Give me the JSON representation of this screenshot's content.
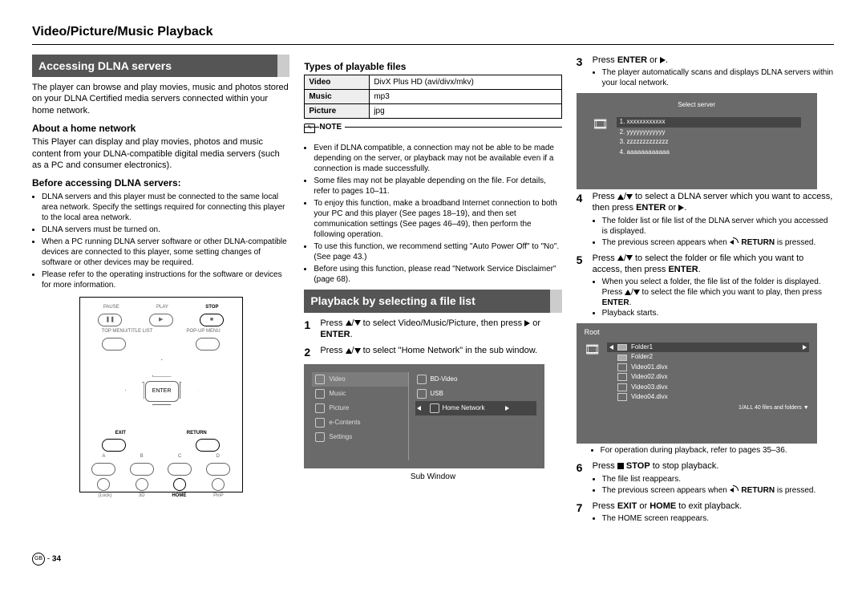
{
  "header": "Video/Picture/Music Playback",
  "col1": {
    "section1": "Accessing DLNA servers",
    "intro": "The player can browse and play movies, music and photos stored on your DLNA Certified media servers connected within your home network.",
    "about_head": "About a home network",
    "about_body": "This Player can display and play movies, photos and music content from your DLNA-compatible digital media servers (such as a PC and consumer electronics).",
    "before_head": "Before accessing DLNA servers:",
    "before_items": [
      "DLNA servers and this player must be connected to the same local area network. Specify the settings required for connecting this player to the local area network.",
      "DLNA servers must be turned on.",
      "When a PC running DLNA server software or other DLNA-compatible devices are connected to this player, some setting changes of software or other devices may be required.",
      "Please refer to the operating instructions for the software or devices for more information."
    ]
  },
  "remote": {
    "pause": "PAUSE",
    "play": "PLAY",
    "stop": "STOP",
    "topmenu": "TOP MENU/TITLE LIST",
    "popup": "POP-UP MENU",
    "enter": "ENTER",
    "exit": "EXIT",
    "return": "RETURN",
    "a": "A",
    "b": "B",
    "c": "C",
    "d": "D",
    "lock": "(Lock)",
    "three_d": "3D",
    "home": "HOME",
    "pinp": "PinP"
  },
  "col2": {
    "types_head": "Types of playable files",
    "types_rows": [
      [
        "Video",
        "DivX Plus HD (avi/divx/mkv)"
      ],
      [
        "Music",
        "mp3"
      ],
      [
        "Picture",
        "jpg"
      ]
    ],
    "note_label": "NOTE",
    "note_items": [
      "Even if DLNA compatible, a connection may not be able to be made depending on the server, or playback may not be available even if a connection is made successfully.",
      "Some files may not be playable depending on the file. For details, refer to pages 10–11.",
      "To enjoy this function, make a broadband Internet connection to both your PC and this player (See pages 18–19), and then set communication settings (See pages 46–49), then perform the following operation.",
      "To use this function, we recommend setting \"Auto Power Off\" to \"No\". (See page 43.)",
      "Before using this function, please read \"Network Service Disclaimer\" (page 68)."
    ],
    "section2": "Playback by selecting a file list",
    "step1_a": "Press ",
    "step1_b": " to select Video/Music/Picture, then press ",
    "step1_c": " or ",
    "step1_enter": "ENTER",
    "step1_d": ".",
    "step2_a": "Press ",
    "step2_b": " to select \"Home Network\" in the sub window.",
    "menu_left": [
      "Video",
      "Music",
      "Picture",
      "e-Contents",
      "Settings"
    ],
    "menu_right": [
      "BD-Video",
      "USB",
      "Home Network"
    ],
    "sub_window": "Sub Window"
  },
  "col3": {
    "step3_a": "Press ",
    "step3_enter": "ENTER",
    "step3_b": " or ",
    "step3_c": ".",
    "step3_li": "The player automatically scans and displays DLNA servers within your local network.",
    "server_title": "Select server",
    "server_items": [
      "1. xxxxxxxxxxxx",
      "2. yyyyyyyyyyyy",
      "3. zzzzzzzzzzzzz",
      "4. aaaaaaaaaaaa"
    ],
    "step4_a": "Press ",
    "step4_b": " to select a DLNA server which you want to access, then press ",
    "step4_enter": "ENTER",
    "step4_c": " or ",
    "step4_d": ".",
    "step4_li": [
      "The folder list or file list of the DLNA server which you accessed is displayed.",
      "The previous screen appears when "
    ],
    "return_label": "RETURN",
    "is_pressed": " is pressed.",
    "step5_a": "Press ",
    "step5_b": " to select the folder or file which you want to access, then press ",
    "step5_enter": "ENTER",
    "step5_c": ".",
    "step5_li1": "When you select a folder, the file list of the folder is displayed. Press ",
    "step5_li1b": " to select the file which you want to play, then press ",
    "step5_li1_enter": "ENTER",
    "step5_li1c": ".",
    "step5_li2": "Playback starts.",
    "root_title": "Root",
    "root_items": [
      "Folder1",
      "Folder2",
      "Video01.divx",
      "Video02.divx",
      "Video03.divx",
      "Video04.divx"
    ],
    "root_foot": "1/ALL   40 files and folders  ▼",
    "step5_li3": "For operation during playback, refer to pages 35–36.",
    "step6_a": "Press ",
    "step6_stop": "STOP",
    "step6_b": " to stop playback.",
    "step6_li": [
      "The file list reappears.",
      "The previous screen appears when "
    ],
    "step7_a": "Press ",
    "step7_exit": "EXIT",
    "step7_b": " or ",
    "step7_home": "HOME",
    "step7_c": " to exit playback.",
    "step7_li": "The HOME screen reappears."
  },
  "page_num": "34",
  "gb": "GB"
}
